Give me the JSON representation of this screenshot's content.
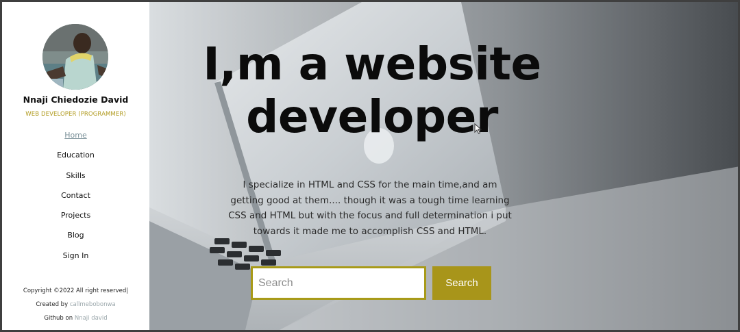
{
  "sidebar": {
    "name": "Nnaji Chiedozie David",
    "role": "WEB DEVELOPER (PROGRAMMER)",
    "nav": [
      "Home",
      "Education",
      "Skills",
      "Contact",
      "Projects",
      "Blog",
      "Sign In"
    ],
    "active_nav": "Home",
    "footer": {
      "copyright": "Copyright ©2022 All right reserved|",
      "created_prefix": "Created by",
      "created_link": "callmebobonwa",
      "github_prefix": "Github on",
      "github_link": "Nnaji david"
    }
  },
  "hero": {
    "title": "I,m a website developer",
    "description": "I specialize in HTML and CSS for the main time,and am getting good at them.... though it was a tough time learning CSS and HTML but with the focus and full determination i put towards it made me to accomplish CSS and HTML.",
    "search": {
      "placeholder": "Search",
      "button_label": "Search"
    }
  },
  "colors": {
    "accent": "#a8951a",
    "role_text": "#b09a1e",
    "active_link": "#7a9098"
  },
  "icons": {
    "cursor": "mouse-pointer-icon"
  }
}
